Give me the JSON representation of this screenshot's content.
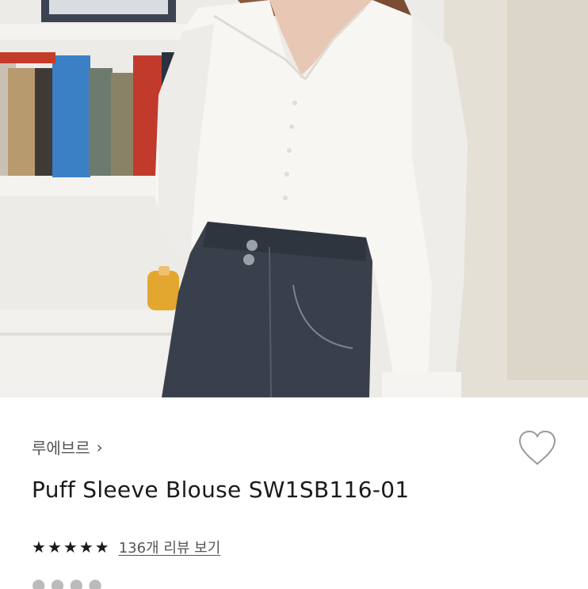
{
  "product_image": {
    "alt": ""
  },
  "brand": {
    "name": "루에브르",
    "chevron": "chevron-right-icon"
  },
  "wishlist": {
    "icon": "heart-outline-icon"
  },
  "product": {
    "name": "Puff Sleeve Blouse SW1SB116-01"
  },
  "rating": {
    "stars": 5,
    "max": 5,
    "review_link": "136개 리뷰 보기"
  },
  "colors": {
    "text": "#1a1a1a",
    "muted": "#555555",
    "heart": "#999999"
  }
}
